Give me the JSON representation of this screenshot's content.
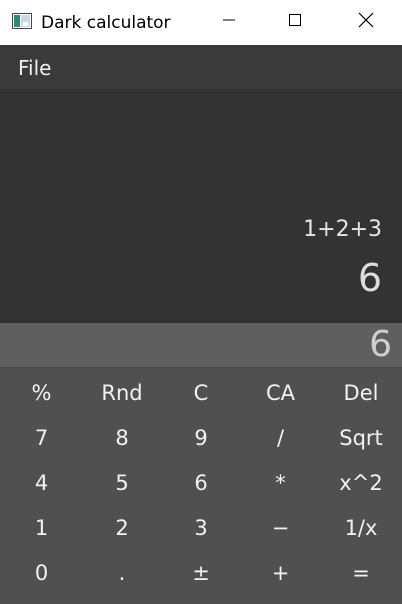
{
  "window": {
    "title": "Dark calculator",
    "icon": "app-window-icon",
    "controls": [
      "minimize-icon",
      "maximize-icon",
      "close-icon"
    ]
  },
  "menu": {
    "file": "File"
  },
  "display": {
    "expression": "1+2+3",
    "result": "6"
  },
  "entry": {
    "value": "6"
  },
  "keys": [
    [
      "%",
      "Rnd",
      "C",
      "CA",
      "Del"
    ],
    [
      "7",
      "8",
      "9",
      "/",
      "Sqrt"
    ],
    [
      "4",
      "5",
      "6",
      "*",
      "x^2"
    ],
    [
      "1",
      "2",
      "3",
      "−",
      "1/x"
    ],
    [
      "0",
      ".",
      "±",
      "+",
      "="
    ]
  ],
  "colors": {
    "menubar": "#3a3a3a",
    "display": "#333333",
    "entry": "#5f5f5f",
    "keypad": "#505050",
    "text": "#f2f2f2"
  }
}
